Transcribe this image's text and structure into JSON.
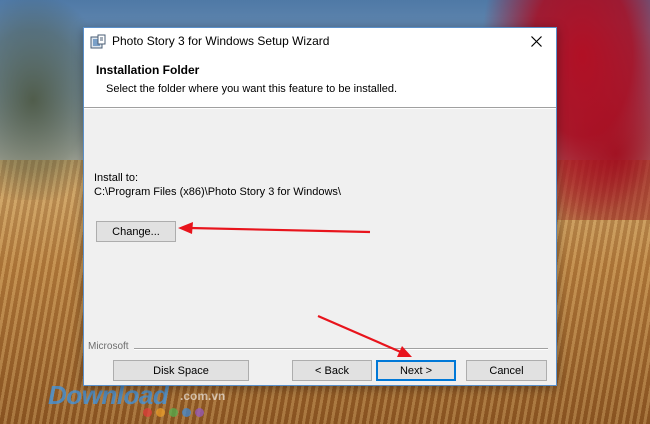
{
  "window": {
    "title": "Photo Story 3 for Windows Setup Wizard"
  },
  "header": {
    "title": "Installation Folder",
    "description": "Select the folder where you want this feature to be installed."
  },
  "install": {
    "label": "Install to:",
    "path": "C:\\Program Files (x86)\\Photo Story 3 for Windows\\"
  },
  "buttons": {
    "change": "Change...",
    "disk_space": "Disk Space",
    "back": "< Back",
    "next": "Next >",
    "cancel": "Cancel"
  },
  "footer": {
    "brand": "Microsoft"
  },
  "watermark": {
    "brand": "Download",
    "domain": ".com.vn"
  },
  "icons": {
    "app": "installer-icon",
    "close": "close-icon"
  },
  "colors": {
    "annotation_arrow": "#e8141c",
    "default_button_border": "#0078d7",
    "window_border": "#5a8fc9"
  }
}
